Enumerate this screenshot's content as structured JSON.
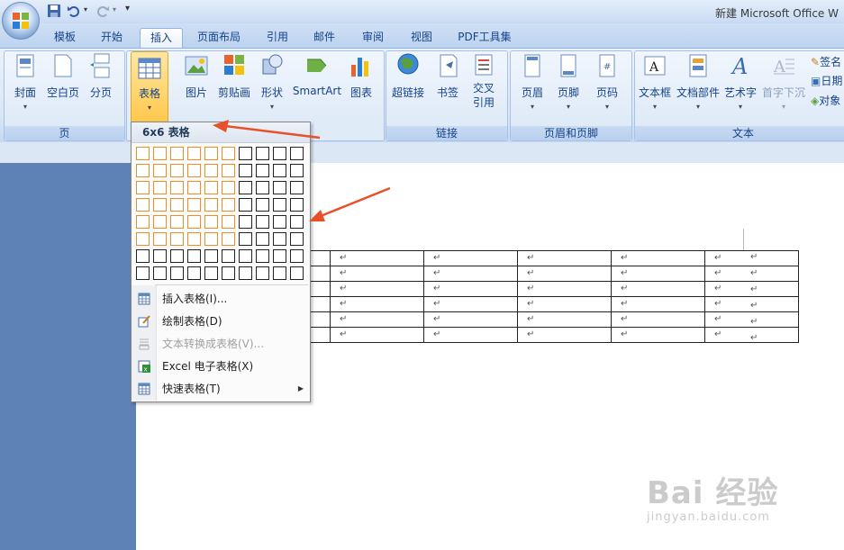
{
  "titlebar": {
    "title": "新建 Microsoft Office W"
  },
  "tabs": [
    {
      "label": "模板"
    },
    {
      "label": "开始"
    },
    {
      "label": "插入"
    },
    {
      "label": "页面布局"
    },
    {
      "label": "引用"
    },
    {
      "label": "邮件"
    },
    {
      "label": "审阅"
    },
    {
      "label": "视图"
    },
    {
      "label": "PDF工具集"
    }
  ],
  "ribbon": {
    "groups": {
      "page": "页",
      "links": "链接",
      "header_footer": "页眉和页脚",
      "text": "文本"
    },
    "buttons": {
      "cover": "封面",
      "blank": "空白页",
      "break": "分页",
      "table": "表格",
      "picture": "图片",
      "clipart": "剪贴画",
      "shapes": "形状",
      "smartart": "SmartArt",
      "chart": "图表",
      "hyperlink": "超链接",
      "bookmark": "书签",
      "crossref": "交叉\n引用",
      "crossref_line1": "交叉",
      "crossref_line2": "引用",
      "header": "页眉",
      "footer": "页脚",
      "pagenum": "页码",
      "textbox": "文本框",
      "quickparts": "文档部件",
      "wordart": "艺术字",
      "dropcap": "首字下沉",
      "signature": "签名",
      "date": "日期",
      "object": "对象"
    }
  },
  "dropdown": {
    "header": "6x6 表格",
    "grid": {
      "cols": 10,
      "rows": 8,
      "selected_cols": 6,
      "selected_rows": 6
    },
    "items": [
      {
        "label": "插入表格(I)...",
        "icon": "insert-table-icon",
        "enabled": true
      },
      {
        "label": "绘制表格(D)",
        "icon": "draw-table-icon",
        "enabled": true
      },
      {
        "label": "文本转换成表格(V)...",
        "icon": "convert-text-icon",
        "enabled": false
      },
      {
        "label": "Excel 电子表格(X)",
        "icon": "excel-icon",
        "enabled": true
      },
      {
        "label": "快速表格(T)",
        "icon": "quick-table-icon",
        "enabled": true,
        "submenu": true
      }
    ]
  },
  "document": {
    "table": {
      "rows": 6,
      "cols": 6,
      "cell_mark": "↵"
    }
  },
  "watermark": {
    "main": "Bai 经验",
    "sub": "jingyan.baidu.com"
  },
  "colors": {
    "accent_orange": "#f08b25",
    "ribbon_blue": "#15428b",
    "arrow_red": "#e8502a"
  }
}
